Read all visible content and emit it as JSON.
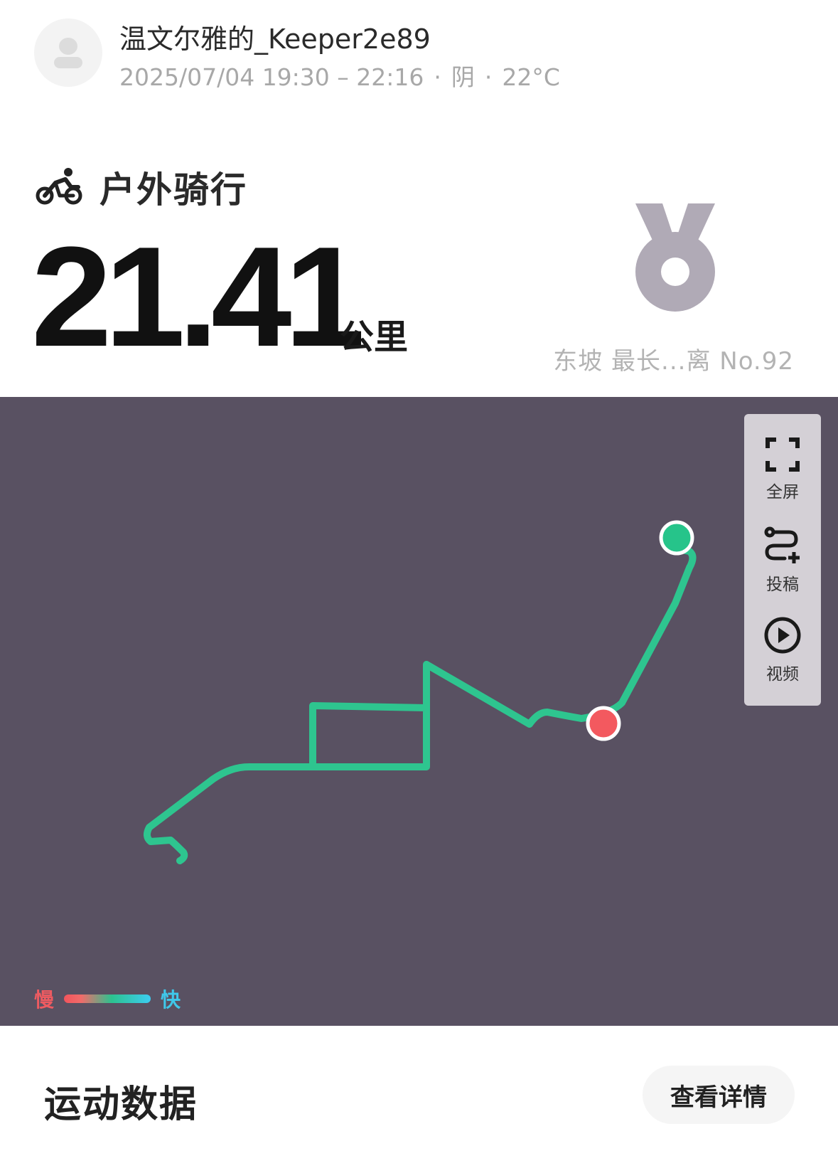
{
  "header": {
    "username": "温文尔雅的_Keeper2e89",
    "date_range": "2025/07/04 19:30 – 22:16",
    "separator": "·",
    "weather": "阴",
    "temperature": "22°C"
  },
  "activity": {
    "type_label": "户外骑行",
    "distance": "21.41",
    "unit": "公里"
  },
  "medal": {
    "text": "东坡 最长...离 No.92",
    "color": "#b0aab6"
  },
  "map": {
    "background_color": "#595162",
    "route_color": "#2ec58f",
    "start_color": "#26c48a",
    "end_color": "#f3595f",
    "tools": [
      {
        "icon": "fullscreen-icon",
        "label": "全屏"
      },
      {
        "icon": "route-submit-icon",
        "label": "投稿"
      },
      {
        "icon": "play-icon",
        "label": "视频"
      }
    ],
    "legend": {
      "slow": "慢",
      "fast": "快"
    }
  },
  "section": {
    "title": "运动数据",
    "detail_button": "查看详情"
  }
}
